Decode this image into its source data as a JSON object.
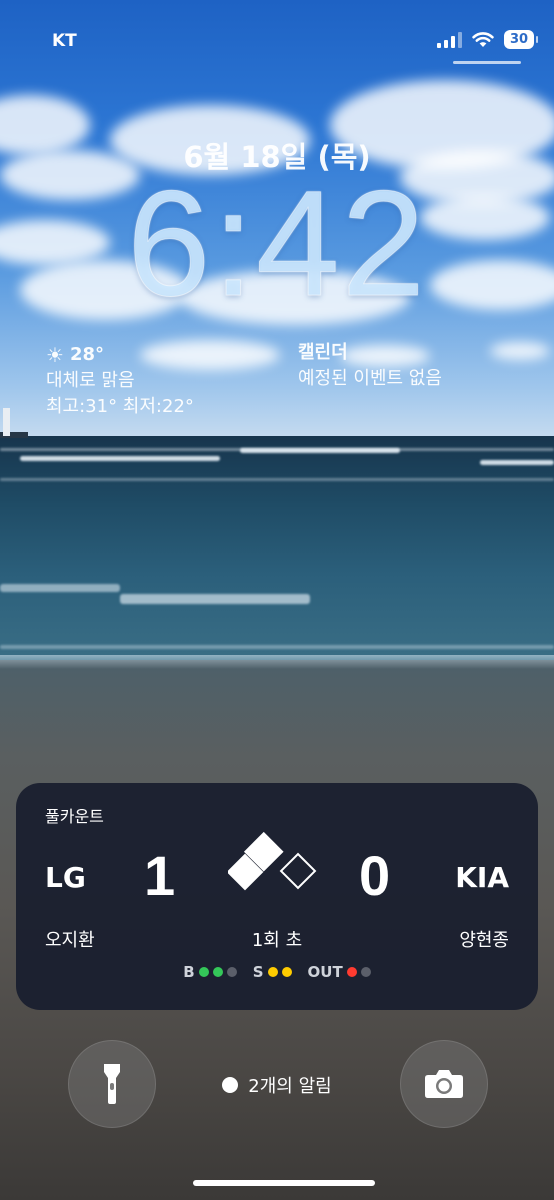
{
  "status_bar": {
    "carrier": "KT",
    "battery": "30"
  },
  "lock_screen": {
    "date": "6월 18일 (목)",
    "time": "6:42"
  },
  "weather": {
    "temperature": "28°",
    "condition": "대체로 맑음",
    "high_low": "최고:31° 최저:22°",
    "icon": "sun-icon"
  },
  "calendar": {
    "title": "캘린더",
    "subtitle": "예정된 이벤트 없음"
  },
  "live_activity": {
    "app_name": "풀카운트",
    "away_team": "LG",
    "home_team": "KIA",
    "away_score": "1",
    "home_score": "0",
    "away_player": "오지환",
    "home_player": "양현종",
    "inning": "1회 초",
    "count": {
      "balls_label": "B",
      "strikes_label": "S",
      "outs_label": "OUT",
      "balls": 2,
      "strikes": 2,
      "outs": 1
    },
    "colors": {
      "ball": "#34c759",
      "strike": "#ffcc00",
      "out": "#ff3b30",
      "empty": "#5b5f6a"
    }
  },
  "notifications": {
    "label": "2개의 알림"
  },
  "buttons": {
    "flashlight_icon": "flashlight-icon",
    "camera_icon": "camera-icon"
  }
}
